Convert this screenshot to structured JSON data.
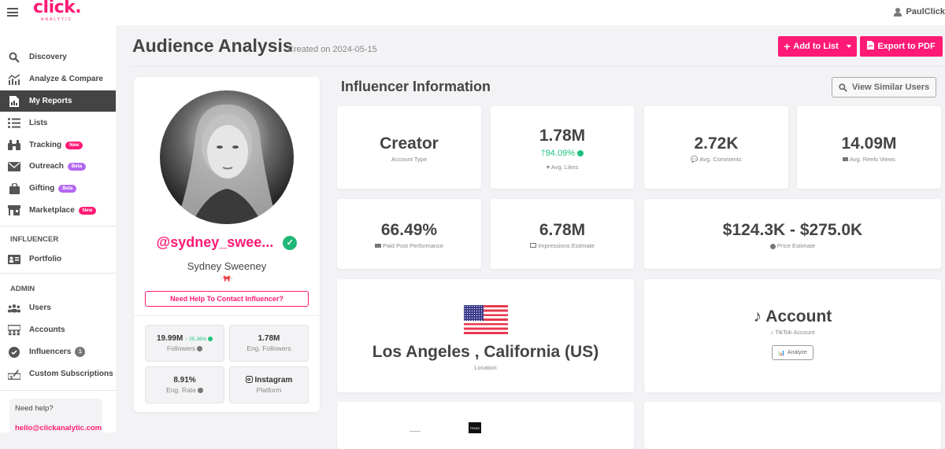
{
  "app": {
    "logo": "click.",
    "logo_sub": "ANALYTIC",
    "user_name": "PaulClick"
  },
  "sidebar": {
    "items": [
      {
        "label": "Discovery",
        "icon": "search-icon"
      },
      {
        "label": "Analyze & Compare",
        "icon": "analyze-icon"
      },
      {
        "label": "My Reports",
        "icon": "report-icon",
        "active": true
      },
      {
        "label": "Lists",
        "icon": "list-icon"
      },
      {
        "label": "Tracking",
        "icon": "binoculars-icon",
        "badge": "New"
      },
      {
        "label": "Outreach",
        "icon": "envelope-icon",
        "badge": "Beta"
      },
      {
        "label": "Gifting",
        "icon": "bag-icon",
        "badge": "Beta"
      },
      {
        "label": "Marketplace",
        "icon": "store-icon",
        "badge": "New"
      }
    ],
    "section_influencer": "INFLUENCER",
    "influencer_items": [
      {
        "label": "Portfolio",
        "icon": "id-card-icon"
      }
    ],
    "section_admin": "ADMIN",
    "admin_items": [
      {
        "label": "Users",
        "icon": "users-icon"
      },
      {
        "label": "Accounts",
        "icon": "accounts-icon"
      },
      {
        "label": "Influencers",
        "icon": "verified-icon",
        "badge": "1"
      },
      {
        "label": "Custom Subscriptions",
        "icon": "subscription-icon"
      }
    ],
    "help": {
      "title": "Need help?",
      "email": "hello@clickanalytic.com"
    }
  },
  "header": {
    "title": "Audience Analysis",
    "created": "Created on 2024-05-15",
    "add_to_list": "Add to List",
    "export_pdf": "Export to PDF"
  },
  "profile": {
    "handle": "@sydney_swee...",
    "name": "Sydney Sweeney",
    "bio_emoji": "·🎀·",
    "contact_button": "Need Help To Contact Influencer?",
    "stats": [
      {
        "value": "19.99M",
        "growth": "25.36%",
        "label": "Followers"
      },
      {
        "value": "1.78M",
        "label": "Eng. Followers"
      },
      {
        "value": "8.91%",
        "label": "Eng. Rate"
      },
      {
        "value": "Instagram",
        "label": "Platform"
      }
    ]
  },
  "info": {
    "title": "Influencer Information",
    "view_similar": "View Similar Users",
    "cards": {
      "account_type": {
        "value": "Creator",
        "label": "Account Type"
      },
      "avg_likes": {
        "value": "1.78M",
        "growth": "94.09%",
        "label": "Avg. Likes"
      },
      "avg_comments": {
        "value": "2.72K",
        "label": "Avg. Comments"
      },
      "avg_reels": {
        "value": "14.09M",
        "label": "Avg. Reels Views"
      },
      "paid_post": {
        "value": "66.49%",
        "label": "Paid Post Performance"
      },
      "impressions": {
        "value": "6.78M",
        "label": "Impressions Estimate"
      },
      "price": {
        "value": "$124.3K - $275.0K",
        "label": "Price Estimate"
      },
      "location": {
        "value": "Los Angeles , California (US)",
        "label": "Location"
      },
      "tiktok": {
        "value": "Account",
        "label": "TikTok Account",
        "button": "Analyze"
      }
    },
    "brand_logo": "FENDI"
  },
  "colors": {
    "accent": "#ff1a75",
    "positive": "#1fc27d",
    "beta": "#b468f0",
    "verified": "#1fb876"
  }
}
